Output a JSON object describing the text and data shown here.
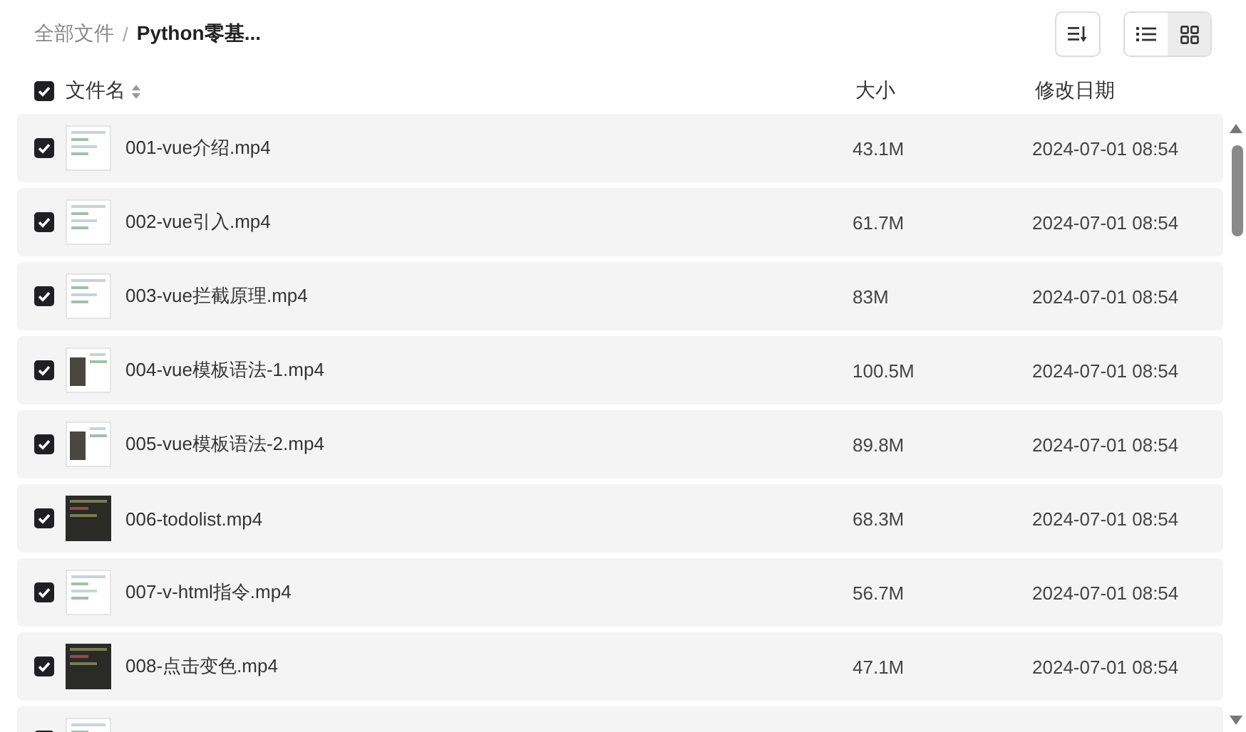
{
  "breadcrumb": [
    {
      "label": "全部文件",
      "current": false
    },
    {
      "label": "Python零基...",
      "current": true
    }
  ],
  "breadcrumb_separator": "/",
  "views": [
    {
      "kind": "list",
      "selected": true
    },
    {
      "kind": "grid",
      "selected": false
    }
  ],
  "columns": {
    "all_checked": true,
    "name": "文件名",
    "size": "大小",
    "modified": "修改日期"
  },
  "rows": [
    {
      "checked": true,
      "kind": "light",
      "name": "001-vue介绍.mp4",
      "size": "43.1M",
      "modified": "2024-07-01 08:54"
    },
    {
      "checked": true,
      "kind": "light",
      "name": "002-vue引入.mp4",
      "size": "61.7M",
      "modified": "2024-07-01 08:54"
    },
    {
      "checked": true,
      "kind": "light",
      "name": "003-vue拦截原理.mp4",
      "size": "83M",
      "modified": "2024-07-01 08:54"
    },
    {
      "checked": true,
      "kind": "photo",
      "name": "004-vue模板语法-1.mp4",
      "size": "100.5M",
      "modified": "2024-07-01 08:54"
    },
    {
      "checked": true,
      "kind": "photo",
      "name": "005-vue模板语法-2.mp4",
      "size": "89.8M",
      "modified": "2024-07-01 08:54"
    },
    {
      "checked": true,
      "kind": "dark",
      "name": "006-todolist.mp4",
      "size": "68.3M",
      "modified": "2024-07-01 08:54"
    },
    {
      "checked": true,
      "kind": "light",
      "name": "007-v-html指令.mp4",
      "size": "56.7M",
      "modified": "2024-07-01 08:54"
    },
    {
      "checked": true,
      "kind": "dark",
      "name": "008-点击变色.mp4",
      "size": "47.1M",
      "modified": "2024-07-01 08:54"
    },
    {
      "checked": true,
      "kind": "light"
    }
  ]
}
